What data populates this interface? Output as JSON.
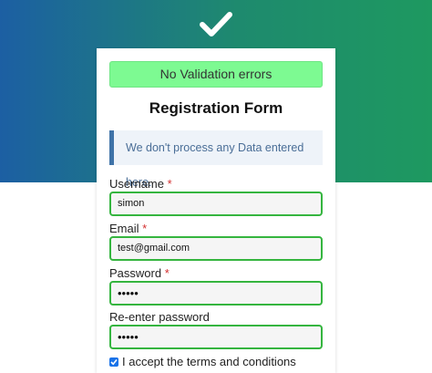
{
  "header": {
    "icon": "checkmark-icon"
  },
  "status": {
    "text": "No Validation errors",
    "color": "#7dfa92"
  },
  "form": {
    "title": "Registration Form",
    "notice": "We don't process any Data entered here.",
    "required_marker": "*",
    "username": {
      "label": "Username",
      "value": "simon"
    },
    "email": {
      "label": "Email",
      "value": "test@gmail.com"
    },
    "password": {
      "label": "Password",
      "value": "•••••"
    },
    "repassword": {
      "label": "Re-enter password",
      "value": "•••••"
    },
    "terms": {
      "label": "I accept the terms and conditions",
      "checked": true
    }
  },
  "colors": {
    "valid_border": "#35b53f",
    "accent_blue": "#1a73e8",
    "gradient_start": "#1c5fa3",
    "gradient_end": "#1e9960"
  }
}
